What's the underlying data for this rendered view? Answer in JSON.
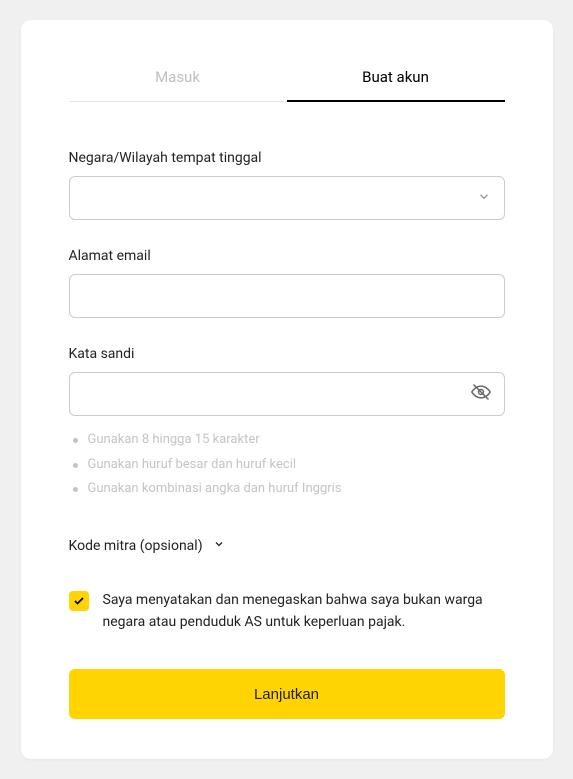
{
  "tabs": {
    "login": "Masuk",
    "signup": "Buat akun"
  },
  "fields": {
    "country": {
      "label": "Negara/Wilayah tempat tinggal",
      "value": ""
    },
    "email": {
      "label": "Alamat email",
      "value": ""
    },
    "password": {
      "label": "Kata sandi",
      "value": "",
      "hints": [
        "Gunakan 8 hingga 15 karakter",
        "Gunakan huruf besar dan huruf kecil",
        "Gunakan kombinasi angka dan huruf Inggris"
      ]
    }
  },
  "partner": {
    "label": "Kode mitra (opsional)"
  },
  "declaration": {
    "checked": true,
    "text": "Saya menyatakan dan menegaskan bahwa saya bukan warga negara atau penduduk AS untuk keperluan pajak."
  },
  "submit": {
    "label": "Lanjutkan"
  },
  "colors": {
    "accent": "#ffd400"
  }
}
